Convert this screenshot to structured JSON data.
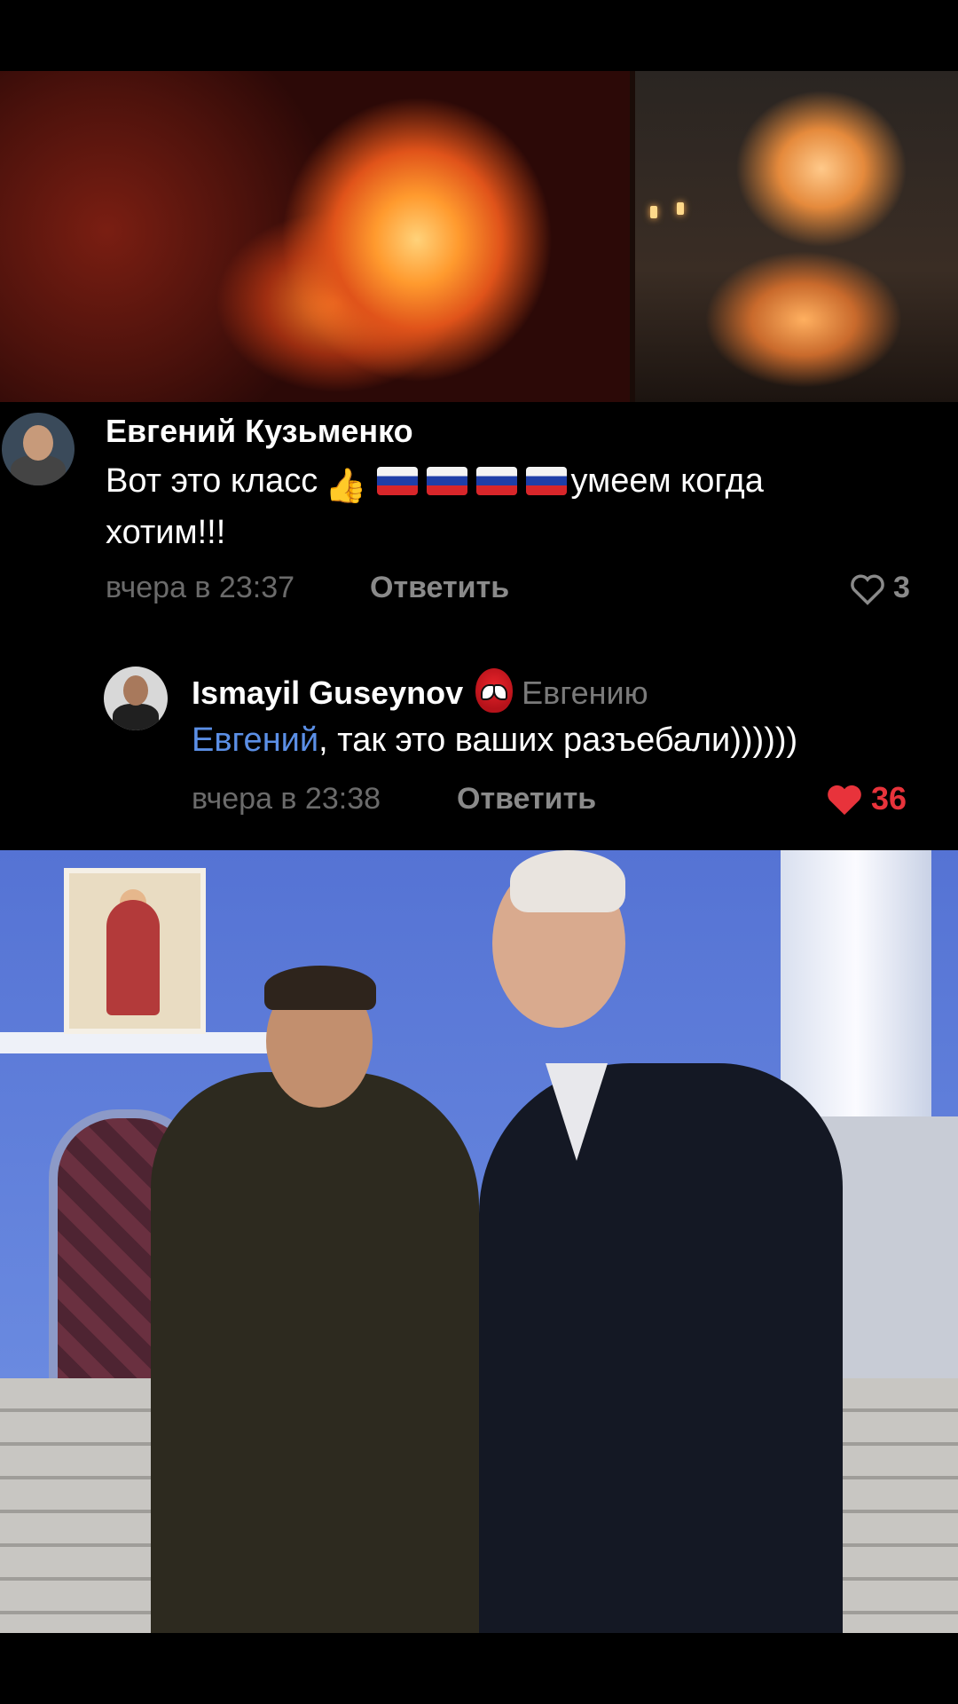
{
  "comments": [
    {
      "author": "Евгений Кузьменко",
      "text_start": "Вот это класс",
      "text_end": "умеем когда",
      "text_line2": "хотим!!!",
      "emojis": [
        "thumbs-up",
        "russia-flag",
        "russia-flag",
        "russia-flag",
        "russia-flag"
      ],
      "timestamp": "вчера в 23:37",
      "reply_label": "Ответить",
      "likes": "3",
      "liked": false
    },
    {
      "author": "Ismayil Guseynov",
      "reply_to": "Евгению",
      "mention": "Евгений",
      "text": ", так это ваших разъебали))))))",
      "timestamp": "вчера в 23:38",
      "reply_label": "Ответить",
      "likes": "36",
      "liked": true
    }
  ],
  "colors": {
    "like_active": "#e8333b",
    "mention": "#5b8fe6",
    "meta": "#6b6b6b"
  }
}
